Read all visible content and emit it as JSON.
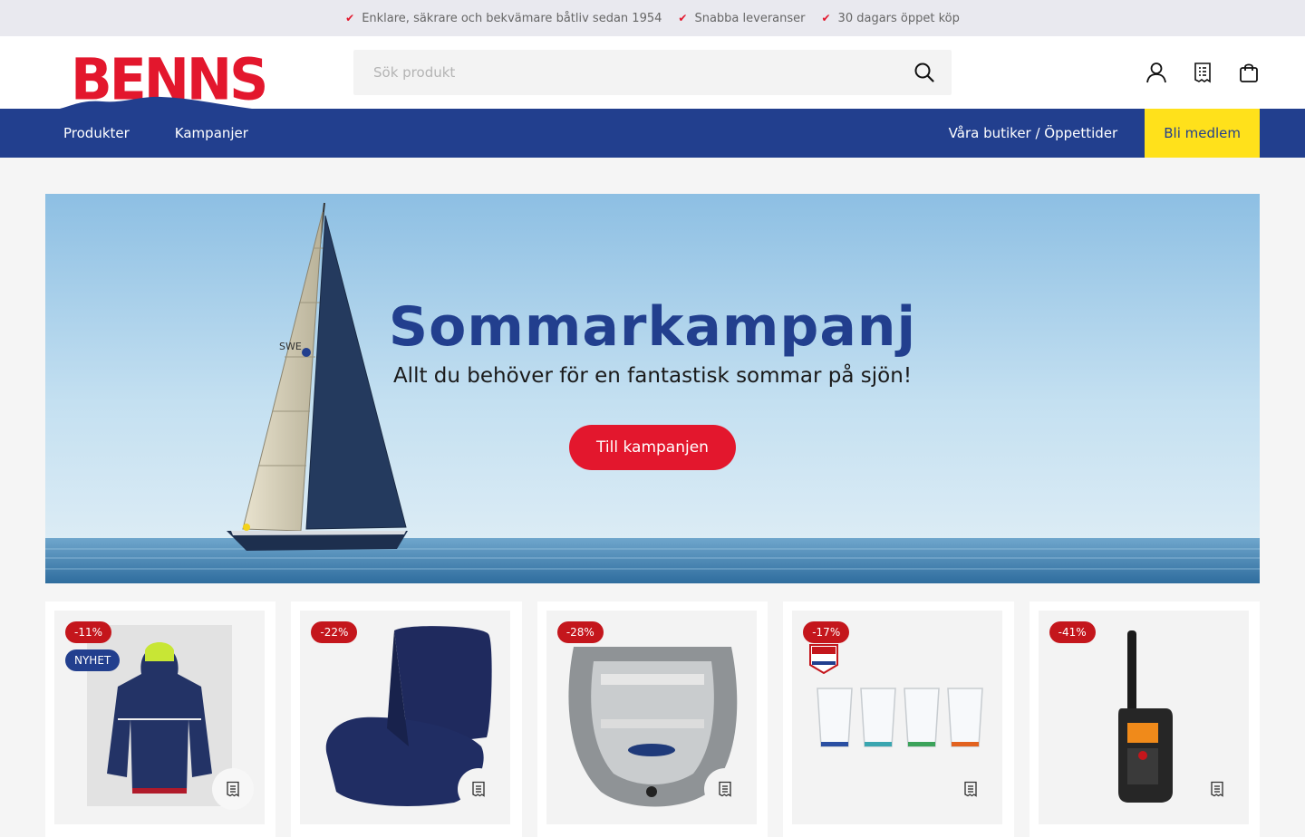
{
  "usp_bar": {
    "items": [
      "Enklare, säkrare och bekvämare båtliv sedan 1954",
      "Snabba leveranser",
      "30 dagars öppet köp"
    ]
  },
  "header": {
    "logo_text": "BENNS",
    "search": {
      "placeholder": "Sök produkt"
    },
    "icons": [
      "account-icon",
      "shopping-list-icon",
      "cart-icon"
    ]
  },
  "nav": {
    "left": [
      "Produkter",
      "Kampanjer"
    ],
    "stores": "Våra butiker / Öppettider",
    "cta": "Bli medlem"
  },
  "hero": {
    "title": "Sommarkampanj",
    "subtitle": "Allt du behöver för en fantastisk sommar på sjön!",
    "button": "Till kampanjen",
    "sail_text": "SWE"
  },
  "products": [
    {
      "discount": "-11%",
      "tag": "NYHET",
      "image": "sailing-jacket"
    },
    {
      "discount": "-22%",
      "image": "boat-seat-cushion"
    },
    {
      "discount": "-28%",
      "image": "inflatable-boat"
    },
    {
      "discount": "-17%",
      "image": "drinking-glasses"
    },
    {
      "discount": "-41%",
      "image": "vhf-radio"
    }
  ],
  "colors": {
    "brand_red": "#e3172d",
    "brand_blue": "#223f8e",
    "cta_yellow": "#ffe11b"
  }
}
